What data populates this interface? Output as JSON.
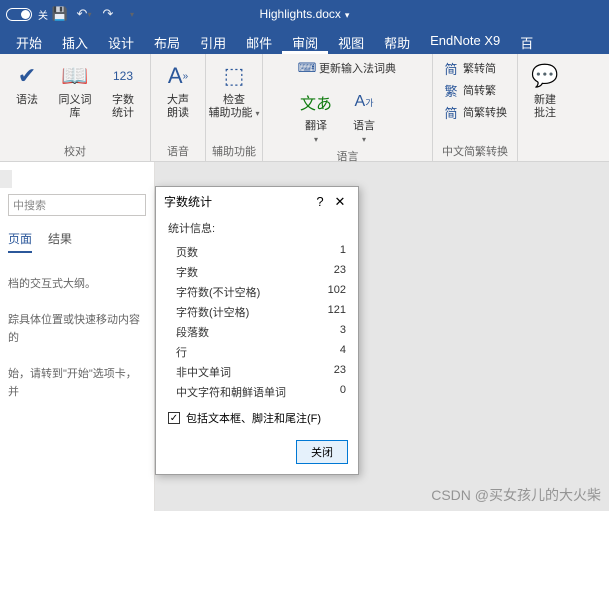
{
  "titlebar": {
    "autosave_off": "关",
    "doc_title": "Highlights.docx"
  },
  "tabs": [
    "开始",
    "插入",
    "设计",
    "布局",
    "引用",
    "邮件",
    "审阅",
    "视图",
    "帮助",
    "EndNote X9",
    "百"
  ],
  "active_tab_index": 6,
  "ribbon": {
    "g0": {
      "label": "校对",
      "cmds": [
        "语法",
        "同义词库",
        "字数\n统计"
      ]
    },
    "g1": {
      "label": "语音",
      "cmds": [
        "大声\n朗读"
      ]
    },
    "g2": {
      "label": "辅助功能",
      "cmds": [
        "检查\n辅助功能"
      ]
    },
    "g3": {
      "label": "语言",
      "cmds": [
        "翻译",
        "语言"
      ],
      "extra": "更新输入法词典"
    },
    "g4": {
      "label": "中文简繁转换",
      "rows": [
        "繁转简",
        "简转繁",
        "简繁转换"
      ]
    },
    "g5": {
      "cmds": [
        "新建\n批注"
      ]
    }
  },
  "nav": {
    "search_ph": "中搜索",
    "tabs": [
      "页面",
      "结果"
    ],
    "lines": [
      "档的交互式大纲。",
      "踪具体位置或快速移动内容的",
      "始，请转到\"开始\"选项卡，并"
    ]
  },
  "dialog": {
    "title": "字数统计",
    "header": "统计信息:",
    "rows": [
      {
        "k": "页数",
        "v": "1"
      },
      {
        "k": "字数",
        "v": "23"
      },
      {
        "k": "字符数(不计空格)",
        "v": "102"
      },
      {
        "k": "字符数(计空格)",
        "v": "121"
      },
      {
        "k": "段落数",
        "v": "3"
      },
      {
        "k": "行",
        "v": "4"
      },
      {
        "k": "非中文单词",
        "v": "23"
      },
      {
        "k": "中文字符和朝鲜语单词",
        "v": "0"
      }
    ],
    "checkbox": "包括文本框、脚注和尾注(F)",
    "close": "关闭"
  },
  "watermark": "CSDN @买女孩儿的大火柴"
}
